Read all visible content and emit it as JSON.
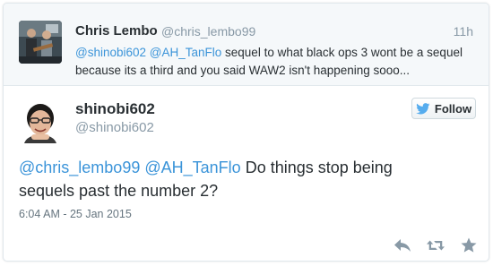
{
  "parent_tweet": {
    "author_name": "Chris Lembo",
    "author_handle": "@chris_lembo99",
    "time": "11h",
    "mention_1": "@shinobi602",
    "mention_2": "@AH_TanFlo",
    "text_line_1": " sequel to what black ops 3 wont be a sequel",
    "text_line_2": "because its a third and you said WAW2 isn't happening sooo..."
  },
  "tweet": {
    "author_name": "shinobi602",
    "author_handle": "@shinobi602",
    "follow_label": "Follow",
    "mention_1": "@chris_lembo99",
    "mention_2": "@AH_TanFlo",
    "text_part_1": " Do things stop being",
    "text_part_2": "sequels past the number 2?",
    "timestamp": "6:04 AM - 25 Jan 2015"
  },
  "icons": {
    "follow": "twitter-bird-icon",
    "reply": "reply-icon",
    "retweet": "retweet-icon",
    "favorite": "star-icon"
  },
  "colors": {
    "link": "#3b94d9",
    "brand": "#55acee",
    "muted": "#8899a6",
    "action_icon": "#8899a6"
  }
}
